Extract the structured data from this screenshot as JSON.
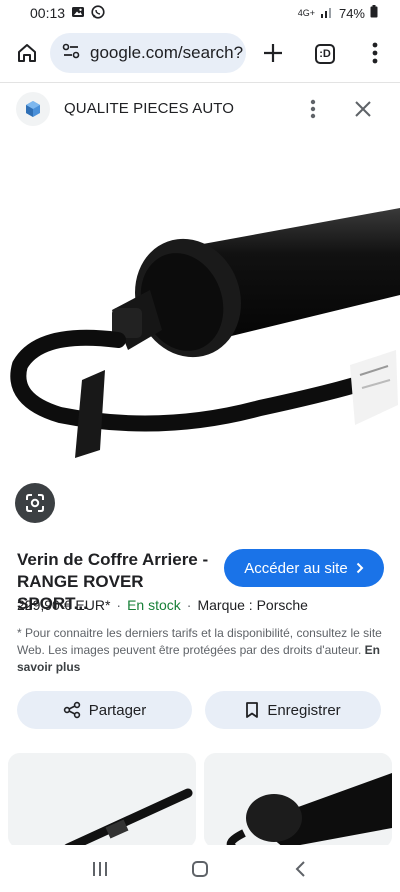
{
  "status_bar": {
    "time": "00:13",
    "network": "4G+",
    "battery": "74%"
  },
  "address_bar": {
    "url": "google.com/search?"
  },
  "site": {
    "name": "QUALITE PIECES AUTO"
  },
  "product": {
    "title": "Verin de Coffre Arriere - RANGE ROVER SPORT...",
    "price": "229,90 € EUR*",
    "separator": "·",
    "stock": "En stock",
    "brand": "Marque : Porsche",
    "visit_label": "Accéder au site",
    "disclaimer": "* Pour connaitre les derniers tarifs et la disponibilité, consultez le site Web. Les images peuvent être protégées par des droits d'auteur.",
    "learn_more": "En savoir plus"
  },
  "actions": {
    "share_label": "Partager",
    "save_label": "Enregistrer"
  },
  "colors": {
    "accent": "#1a73e8",
    "stock_green": "#188038",
    "pill_bg": "#e8eef7"
  },
  "icons": {
    "home": "home-icon",
    "site_info": "site-info-icon",
    "new_tab": "plus-icon",
    "tabs": "tab-switcher-icon",
    "menu": "more-vert-icon",
    "close": "close-icon",
    "lens": "google-lens-icon",
    "share": "share-icon",
    "bookmark": "bookmark-icon",
    "chevron": "chevron-right-icon"
  }
}
